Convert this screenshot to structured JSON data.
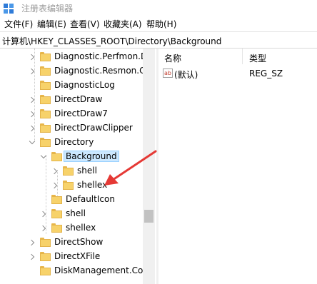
{
  "window": {
    "title": "注册表编辑器",
    "icon": "registry-editor-icon"
  },
  "menu": {
    "items": [
      "文件(F)",
      "编辑(E)",
      "查看(V)",
      "收藏夹(A)",
      "帮助(H)"
    ]
  },
  "address": {
    "path": "计算机\\HKEY_CLASSES_ROOT\\Directory\\Background"
  },
  "tree": {
    "items": [
      {
        "label": "Diagnostic.Perfmon.D",
        "expander": "collapsed"
      },
      {
        "label": "Diagnostic.Resmon.C",
        "expander": "collapsed"
      },
      {
        "label": "DiagnosticLog",
        "expander": "none"
      },
      {
        "label": "DirectDraw",
        "expander": "collapsed"
      },
      {
        "label": "DirectDraw7",
        "expander": "collapsed"
      },
      {
        "label": "DirectDrawClipper",
        "expander": "collapsed"
      },
      {
        "label": "Directory",
        "expander": "expanded"
      },
      {
        "label": "Background",
        "expander": "expanded",
        "selected": true
      },
      {
        "label": "shell",
        "expander": "collapsed"
      },
      {
        "label": "shellex",
        "expander": "collapsed"
      },
      {
        "label": "DefaultIcon",
        "expander": "none"
      },
      {
        "label": "shell",
        "expander": "collapsed"
      },
      {
        "label": "shellex",
        "expander": "collapsed"
      },
      {
        "label": "DirectShow",
        "expander": "collapsed"
      },
      {
        "label": "DirectXFile",
        "expander": "collapsed"
      },
      {
        "label": "DiskManagement.Co",
        "expander": "none"
      }
    ]
  },
  "list": {
    "headers": {
      "name": "名称",
      "type": "类型"
    },
    "rows": [
      {
        "icon": "string-value-icon",
        "icon_text": "ab",
        "name": "(默认)",
        "type": "REG_SZ"
      }
    ]
  },
  "colors": {
    "selection": "#cce8ff",
    "folder": "#f7d26a",
    "annotation_arrow": "#e53935"
  }
}
